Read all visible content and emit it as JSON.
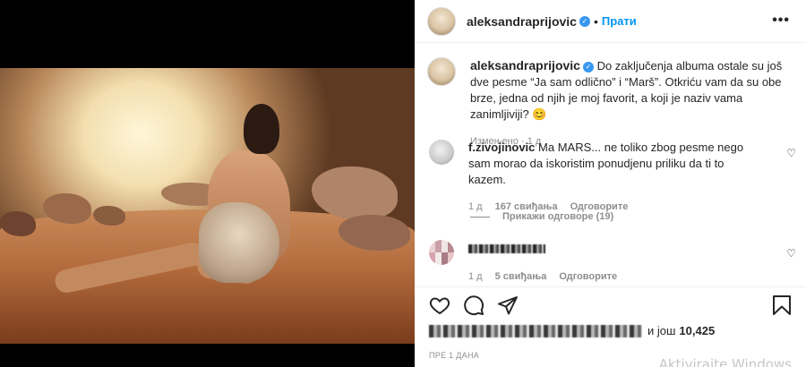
{
  "header": {
    "username": "aleksandraprijovic",
    "follow_label": "Прати",
    "separator": "•",
    "more_label": "•••"
  },
  "caption": {
    "username": "aleksandraprijovic",
    "text": "Do zaključenja albuma ostale su još dve pesme “Ja sam odlično” i “Marš”. Otkriću vam da su obe brze, jedna od njih je moj favorit, a koji je naziv vama zanimljiviji? 😊",
    "edited_label": "Измењено",
    "time": "1 д"
  },
  "comments": [
    {
      "username": "f.zivojinovic",
      "text": "Ma MARS... ne toliko zbog pesme nego sam morao da iskoristim ponudjenu priliku da ti to kazem.",
      "time": "1 д",
      "likes": "167 свиђања",
      "reply_label": "Одговорите",
      "view_replies": "Прикажи одговоре (19)"
    },
    {
      "username": "",
      "text": "",
      "time": "1 д",
      "likes": "5 свиђања",
      "reply_label": "Одговорите"
    }
  ],
  "likes": {
    "and_label": "и још",
    "count": "10,425"
  },
  "posted": "ПРЕ 1 ДАНА",
  "watermark": "Aktivirajte Windows",
  "icons": [
    "heart-icon",
    "comment-icon",
    "share-icon",
    "bookmark-icon",
    "more-icon",
    "verified-icon"
  ],
  "colors": {
    "accent": "#0095f6",
    "verified": "#3897f0",
    "text": "#262626",
    "muted": "#8e8e8e"
  }
}
